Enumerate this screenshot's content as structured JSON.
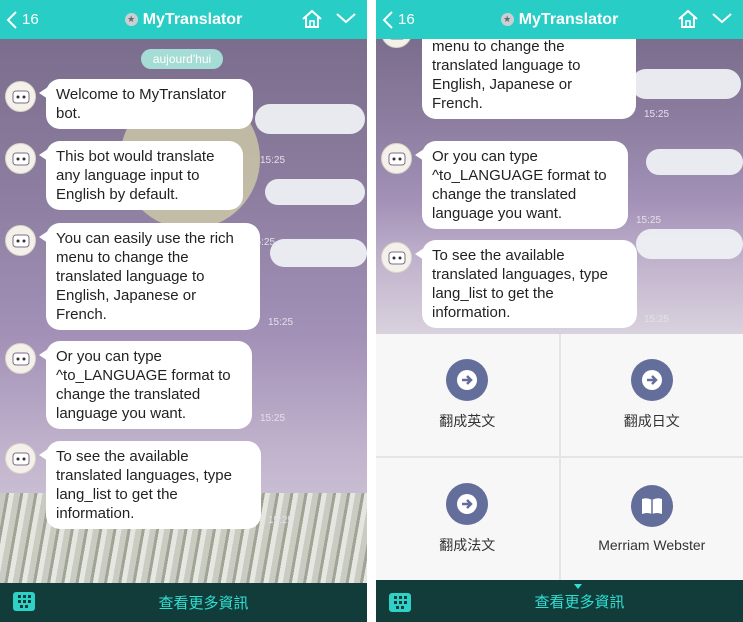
{
  "header": {
    "back_count": "16",
    "title": "MyTranslator",
    "badge_glyph": "★"
  },
  "chat": {
    "date_label": "aujourd'hui",
    "messages": [
      {
        "text": "Welcome to MyTranslator bot.",
        "time": "15:25"
      },
      {
        "text": "This bot would translate any language input to English by default.",
        "time": "15:25"
      },
      {
        "text": "You can easily use the rich menu to change the translated language to English, Japanese or French.",
        "time": "15:25"
      },
      {
        "text": "Or you can type ^to_LANGUAGE format to change the translated language you want.",
        "time": "15:25"
      },
      {
        "text": "To see the available translated languages, type lang_list to get the information.",
        "time": "15:25"
      }
    ]
  },
  "rich_menu": {
    "items": [
      {
        "label": "翻成英文",
        "icon": "arrow-right-icon"
      },
      {
        "label": "翻成日文",
        "icon": "arrow-right-icon"
      },
      {
        "label": "翻成法文",
        "icon": "arrow-right-icon"
      },
      {
        "label": "Merriam Webster",
        "icon": "book-icon"
      }
    ]
  },
  "bottom_bar": {
    "label": "查看更多資訊"
  },
  "colors": {
    "header": "#28cdc6",
    "bottom_bar": "#123c3a",
    "bottom_text": "#2fe0d4",
    "rich_menu_icon": "#646e9a"
  }
}
